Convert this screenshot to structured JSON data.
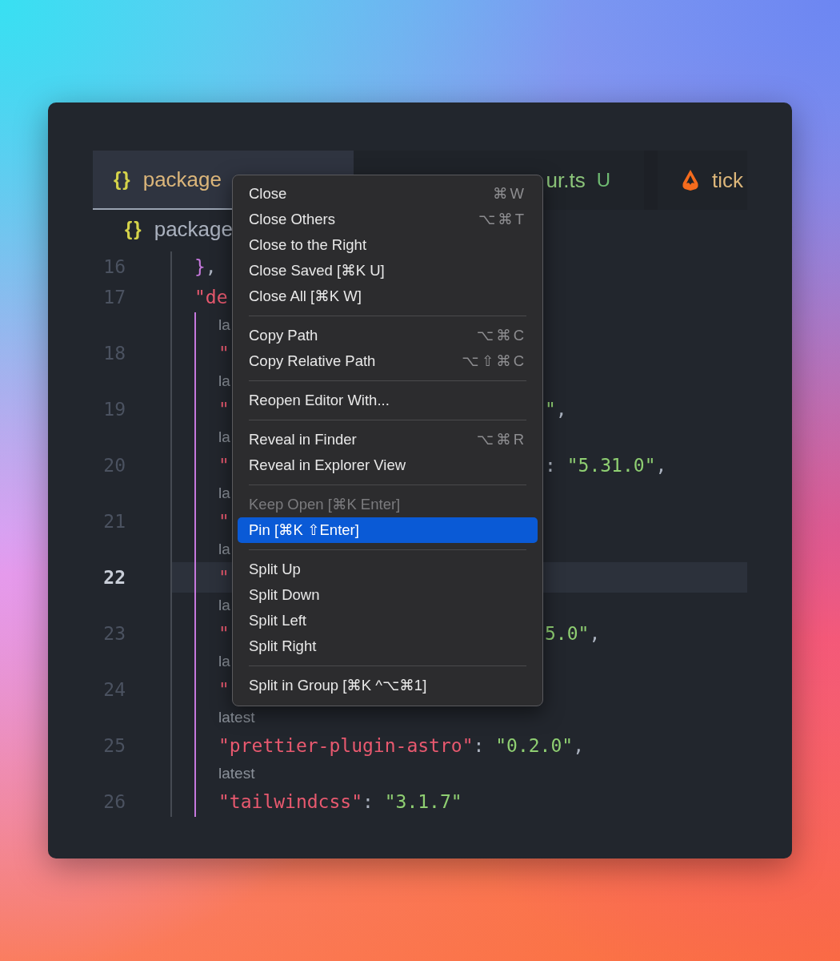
{
  "tabs": [
    {
      "kind": "json",
      "icon_text": "{}",
      "label": "package",
      "selected": true
    },
    {
      "kind": "ts",
      "label": "ur.ts",
      "badge": "U",
      "selected": false
    },
    {
      "kind": "logo",
      "label": "tick",
      "selected": false
    }
  ],
  "breadcrumb": {
    "icon_text": "{}",
    "label": "package"
  },
  "lines": [
    {
      "number": "16",
      "current": false,
      "guides": [
        {
          "active": false
        }
      ],
      "left": [
        {
          "kind": "brace",
          "text": "}"
        },
        {
          "kind": "punct",
          "text": ","
        }
      ]
    },
    {
      "number": "17",
      "current": false,
      "guides": [
        {
          "active": false
        }
      ],
      "left": [
        {
          "kind": "key",
          "text": "\"de"
        }
      ]
    },
    {
      "number": "18",
      "current": false,
      "lens": "la",
      "guides": [
        {
          "active": false
        },
        {
          "active": true
        }
      ],
      "left": [
        {
          "kind": "key",
          "text": "\""
        }
      ]
    },
    {
      "number": "19",
      "current": false,
      "lens": "la",
      "guides": [
        {
          "active": false
        },
        {
          "active": true
        }
      ],
      "left": [
        {
          "kind": "key",
          "text": "\""
        }
      ],
      "right": [
        {
          "kind": "string",
          "text": "\""
        },
        {
          "kind": "punct",
          "text": ","
        }
      ]
    },
    {
      "number": "20",
      "current": false,
      "lens": "la",
      "guides": [
        {
          "active": false
        },
        {
          "active": true
        }
      ],
      "left": [
        {
          "kind": "key",
          "text": "\""
        }
      ],
      "right": [
        {
          "kind": "punct",
          "text": ": "
        },
        {
          "kind": "string",
          "text": "\"5.31.0\""
        },
        {
          "kind": "punct",
          "text": ","
        }
      ]
    },
    {
      "number": "21",
      "current": false,
      "lens": "la",
      "guides": [
        {
          "active": false
        },
        {
          "active": true
        }
      ],
      "left": [
        {
          "kind": "key",
          "text": "\""
        }
      ]
    },
    {
      "number": "22",
      "current": true,
      "lens": "la",
      "guides": [
        {
          "active": false
        },
        {
          "active": true
        }
      ],
      "left": [
        {
          "kind": "key",
          "text": "\""
        }
      ]
    },
    {
      "number": "23",
      "current": false,
      "lens": "la",
      "guides": [
        {
          "active": false
        },
        {
          "active": true
        }
      ],
      "left": [
        {
          "kind": "key",
          "text": "\""
        }
      ],
      "right": [
        {
          "kind": "string",
          "text": "5.0\""
        },
        {
          "kind": "punct",
          "text": ","
        }
      ]
    },
    {
      "number": "24",
      "current": false,
      "lens": "la",
      "guides": [
        {
          "active": false
        },
        {
          "active": true
        }
      ],
      "left": [
        {
          "kind": "key",
          "text": "\""
        }
      ]
    },
    {
      "number": "25",
      "current": false,
      "lens": "latest",
      "guides": [
        {
          "active": false
        },
        {
          "active": true
        }
      ],
      "left": [
        {
          "kind": "key",
          "text": "\"prettier-plugin-astro\""
        },
        {
          "kind": "punct",
          "text": ": "
        },
        {
          "kind": "string",
          "text": "\"0.2.0\""
        },
        {
          "kind": "punct",
          "text": ","
        }
      ]
    },
    {
      "number": "26",
      "current": false,
      "lens": "latest",
      "guides": [
        {
          "active": false
        },
        {
          "active": true
        }
      ],
      "left": [
        {
          "kind": "key",
          "text": "\"tailwindcss\""
        },
        {
          "kind": "punct",
          "text": ": "
        },
        {
          "kind": "string",
          "text": "\"3.1.7\""
        }
      ]
    }
  ],
  "menu": [
    {
      "kind": "item",
      "label": "Close",
      "shortcut": "⌘W",
      "disabled": false,
      "selected": false
    },
    {
      "kind": "item",
      "label": "Close Others",
      "shortcut": "⌥⌘T",
      "disabled": false,
      "selected": false
    },
    {
      "kind": "item",
      "label": "Close to the Right",
      "disabled": false,
      "selected": false
    },
    {
      "kind": "item",
      "label": "Close Saved [⌘K U]",
      "disabled": false,
      "selected": false
    },
    {
      "kind": "item",
      "label": "Close All [⌘K W]",
      "disabled": false,
      "selected": false
    },
    {
      "kind": "separator"
    },
    {
      "kind": "item",
      "label": "Copy Path",
      "shortcut": "⌥⌘C",
      "disabled": false,
      "selected": false
    },
    {
      "kind": "item",
      "label": "Copy Relative Path",
      "shortcut": "⌥⇧⌘C",
      "disabled": false,
      "selected": false
    },
    {
      "kind": "separator"
    },
    {
      "kind": "item",
      "label": "Reopen Editor With...",
      "disabled": false,
      "selected": false
    },
    {
      "kind": "separator"
    },
    {
      "kind": "item",
      "label": "Reveal in Finder",
      "shortcut": "⌥⌘R",
      "disabled": false,
      "selected": false
    },
    {
      "kind": "item",
      "label": "Reveal in Explorer View",
      "disabled": false,
      "selected": false
    },
    {
      "kind": "separator"
    },
    {
      "kind": "item",
      "label": "Keep Open [⌘K Enter]",
      "disabled": true,
      "selected": false
    },
    {
      "kind": "item",
      "label": "Pin [⌘K ⇧Enter]",
      "disabled": false,
      "selected": true
    },
    {
      "kind": "separator"
    },
    {
      "kind": "item",
      "label": "Split Up",
      "disabled": false,
      "selected": false
    },
    {
      "kind": "item",
      "label": "Split Down",
      "disabled": false,
      "selected": false
    },
    {
      "kind": "item",
      "label": "Split Left",
      "disabled": false,
      "selected": false
    },
    {
      "kind": "item",
      "label": "Split Right",
      "disabled": false,
      "selected": false
    },
    {
      "kind": "separator"
    },
    {
      "kind": "item",
      "label": "Split in Group [⌘K ^⌥⌘1]",
      "disabled": false,
      "selected": false
    }
  ]
}
